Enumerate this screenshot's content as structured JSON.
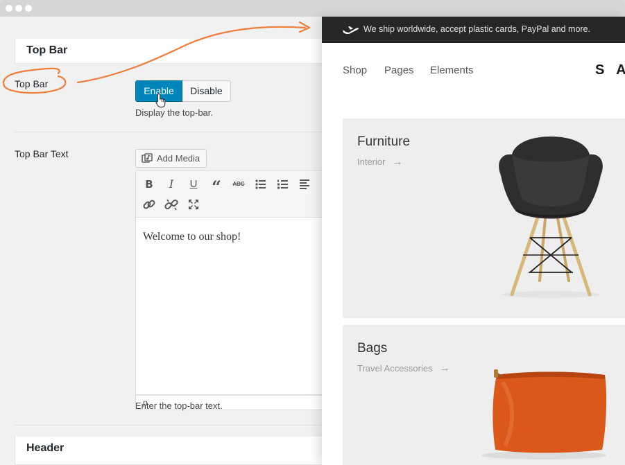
{
  "admin": {
    "sections": {
      "top_bar_title": "Top Bar",
      "header_title": "Header"
    },
    "top_bar": {
      "label": "Top Bar",
      "enable_label": "Enable",
      "disable_label": "Disable",
      "selected": "Enable",
      "description": "Display the top-bar."
    },
    "top_bar_text": {
      "label": "Top Bar Text",
      "add_media_label": "Add Media",
      "toolbar_icons": [
        "bold-icon",
        "italic-icon",
        "underline-icon",
        "blockquote-icon",
        "strikethrough-icon",
        "bulleted-list-icon",
        "numbered-list-icon",
        "align-left-icon",
        "insert-link-icon",
        "remove-link-icon",
        "fullscreen-icon"
      ],
      "content": "Welcome to our shop!",
      "path": "p",
      "description": "Enter the top-bar text."
    }
  },
  "store": {
    "topbar_message": "We ship worldwide, accept plastic cards, PayPal and more.",
    "nav": [
      "Shop",
      "Pages",
      "Elements"
    ],
    "logo_visible": "S A",
    "cards": [
      {
        "title": "Furniture",
        "subtitle": "Interior",
        "arrow": "→"
      },
      {
        "title": "Bags",
        "subtitle": "Travel Accessories",
        "arrow": "→"
      }
    ]
  },
  "colors": {
    "primary_button": "#0085ba",
    "annotation": "#f07c3a",
    "topbar_bg": "#262626",
    "chair": "#2e2e2e",
    "bag": "#d9581a"
  }
}
